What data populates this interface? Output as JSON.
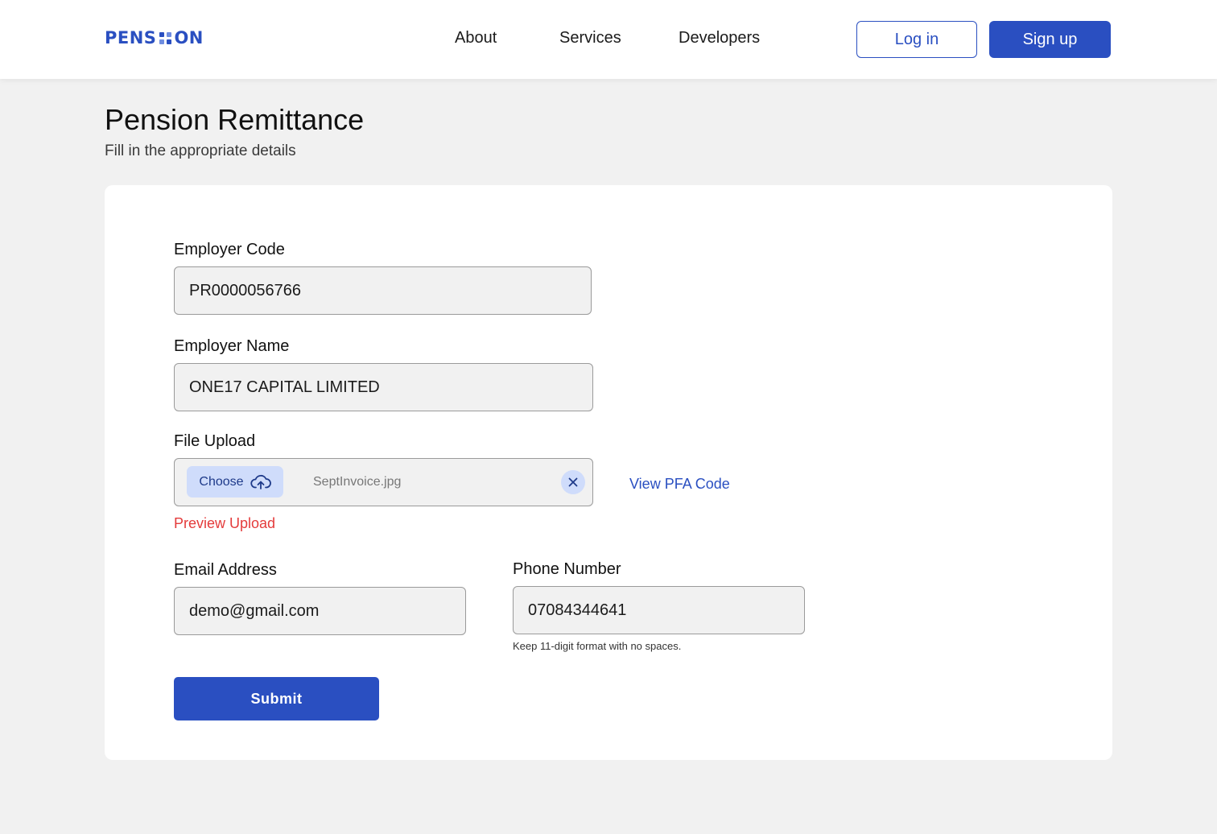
{
  "header": {
    "logo": {
      "left": "PENS",
      "right": "ON"
    },
    "nav": [
      "About",
      "Services",
      "Developers"
    ],
    "login_label": "Log in",
    "signup_label": "Sign up"
  },
  "page": {
    "title": "Pension Remittance",
    "subtitle": "Fill in the appropriate details"
  },
  "form": {
    "employer_code": {
      "label": "Employer Code",
      "value": "PR0000056766"
    },
    "employer_name": {
      "label": "Employer Name",
      "value": "ONE17 CAPITAL LIMITED"
    },
    "file_upload": {
      "label": "File Upload",
      "choose_label": "Choose",
      "file_name": "SeptInvoice.jpg",
      "preview_label": "Preview Upload",
      "pfa_link": "View PFA Code"
    },
    "email": {
      "label": "Email Address",
      "value": "demo@gmail.com"
    },
    "phone": {
      "label": "Phone Number",
      "value": "07084344641",
      "hint": "Keep 11-digit format with no spaces."
    },
    "submit_label": "Submit"
  },
  "colors": {
    "primary": "#2a4fc1",
    "chip": "#cfdcfb",
    "error": "#e43b3b",
    "page_bg": "#f1f1f1"
  }
}
